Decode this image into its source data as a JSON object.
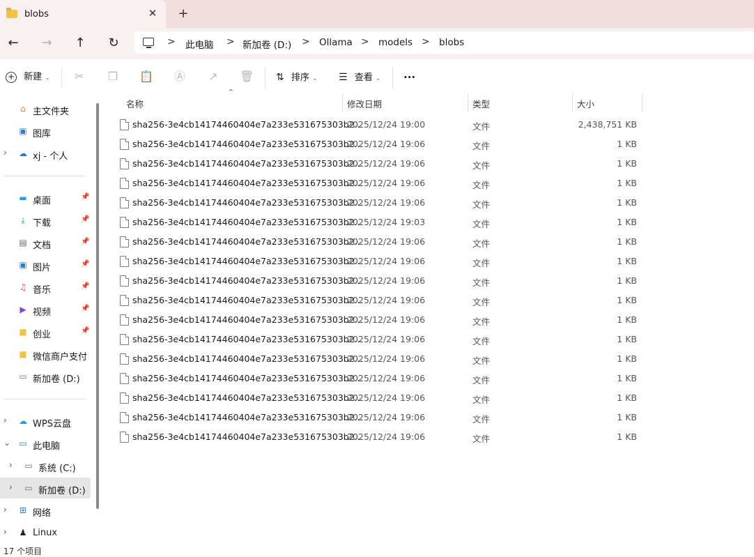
{
  "window": {
    "tab_title": "blobs",
    "close_glyph": "✕",
    "new_tab_glyph": "+"
  },
  "nav": {
    "back_glyph": "←",
    "forward_glyph": "→",
    "up_glyph": "↑",
    "refresh_glyph": "↻"
  },
  "breadcrumb": [
    "此电脑",
    "新加卷 (D:)",
    "Ollama",
    "models",
    "blobs"
  ],
  "breadcrumb_sep": ">",
  "toolbar": {
    "new_label": "新建",
    "sort_label": "排序",
    "view_label": "查看",
    "more_glyph": "···"
  },
  "sidebar": {
    "home": "主文件夹",
    "gallery": "图库",
    "onedrive": "xj - 个人",
    "desktop": "桌面",
    "downloads": "下载",
    "documents": "文档",
    "pictures": "图片",
    "music": "音乐",
    "videos": "视频",
    "chuangye": "创业",
    "wechatpay": "微信商户支付",
    "d_drive_quick": "新加卷 (D:)",
    "wps": "WPS云盘",
    "thispc": "此电脑",
    "c_drive": "系统 (C:)",
    "d_drive": "新加卷 (D:)",
    "network": "网络",
    "linux": "Linux"
  },
  "columns": {
    "name": "名称",
    "date": "修改日期",
    "type": "类型",
    "size": "大小"
  },
  "files": [
    {
      "name": "sha256-3e4cb14174460404e7a233e531675303b2...",
      "date": "2025/12/24 19:00",
      "type": "文件",
      "size": "2,438,751 KB"
    },
    {
      "name": "sha256-3e4cb14174460404e7a233e531675303b2...",
      "date": "2025/12/24 19:06",
      "type": "文件",
      "size": "1 KB"
    },
    {
      "name": "sha256-3e4cb14174460404e7a233e531675303b2...",
      "date": "2025/12/24 19:06",
      "type": "文件",
      "size": "1 KB"
    },
    {
      "name": "sha256-3e4cb14174460404e7a233e531675303b2...",
      "date": "2025/12/24 19:06",
      "type": "文件",
      "size": "1 KB"
    },
    {
      "name": "sha256-3e4cb14174460404e7a233e531675303b2...",
      "date": "2025/12/24 19:06",
      "type": "文件",
      "size": "1 KB"
    },
    {
      "name": "sha256-3e4cb14174460404e7a233e531675303b2...",
      "date": "2025/12/24 19:03",
      "type": "文件",
      "size": "1 KB"
    },
    {
      "name": "sha256-3e4cb14174460404e7a233e531675303b2...",
      "date": "2025/12/24 19:06",
      "type": "文件",
      "size": "1 KB"
    },
    {
      "name": "sha256-3e4cb14174460404e7a233e531675303b2...",
      "date": "2025/12/24 19:06",
      "type": "文件",
      "size": "1 KB"
    },
    {
      "name": "sha256-3e4cb14174460404e7a233e531675303b2...",
      "date": "2025/12/24 19:06",
      "type": "文件",
      "size": "1 KB"
    },
    {
      "name": "sha256-3e4cb14174460404e7a233e531675303b2...",
      "date": "2025/12/24 19:06",
      "type": "文件",
      "size": "1 KB"
    },
    {
      "name": "sha256-3e4cb14174460404e7a233e531675303b2...",
      "date": "2025/12/24 19:06",
      "type": "文件",
      "size": "1 KB"
    },
    {
      "name": "sha256-3e4cb14174460404e7a233e531675303b2...",
      "date": "2025/12/24 19:06",
      "type": "文件",
      "size": "1 KB"
    },
    {
      "name": "sha256-3e4cb14174460404e7a233e531675303b2...",
      "date": "2025/12/24 19:06",
      "type": "文件",
      "size": "1 KB"
    },
    {
      "name": "sha256-3e4cb14174460404e7a233e531675303b2...",
      "date": "2025/12/24 19:06",
      "type": "文件",
      "size": "1 KB"
    },
    {
      "name": "sha256-3e4cb14174460404e7a233e531675303b2...",
      "date": "2025/12/24 19:06",
      "type": "文件",
      "size": "1 KB"
    },
    {
      "name": "sha256-3e4cb14174460404e7a233e531675303b2...",
      "date": "2025/12/24 19:06",
      "type": "文件",
      "size": "1 KB"
    },
    {
      "name": "sha256-3e4cb14174460404e7a233e531675303b2...",
      "date": "2025/12/24 19:06",
      "type": "文件",
      "size": "1 KB"
    }
  ],
  "status": {
    "item_count": "17 个项目"
  },
  "colors": {
    "titlebar_bg": "#f3dede",
    "folder_yellow": "#f2c14a",
    "selected_bg": "#e6e6e6"
  }
}
